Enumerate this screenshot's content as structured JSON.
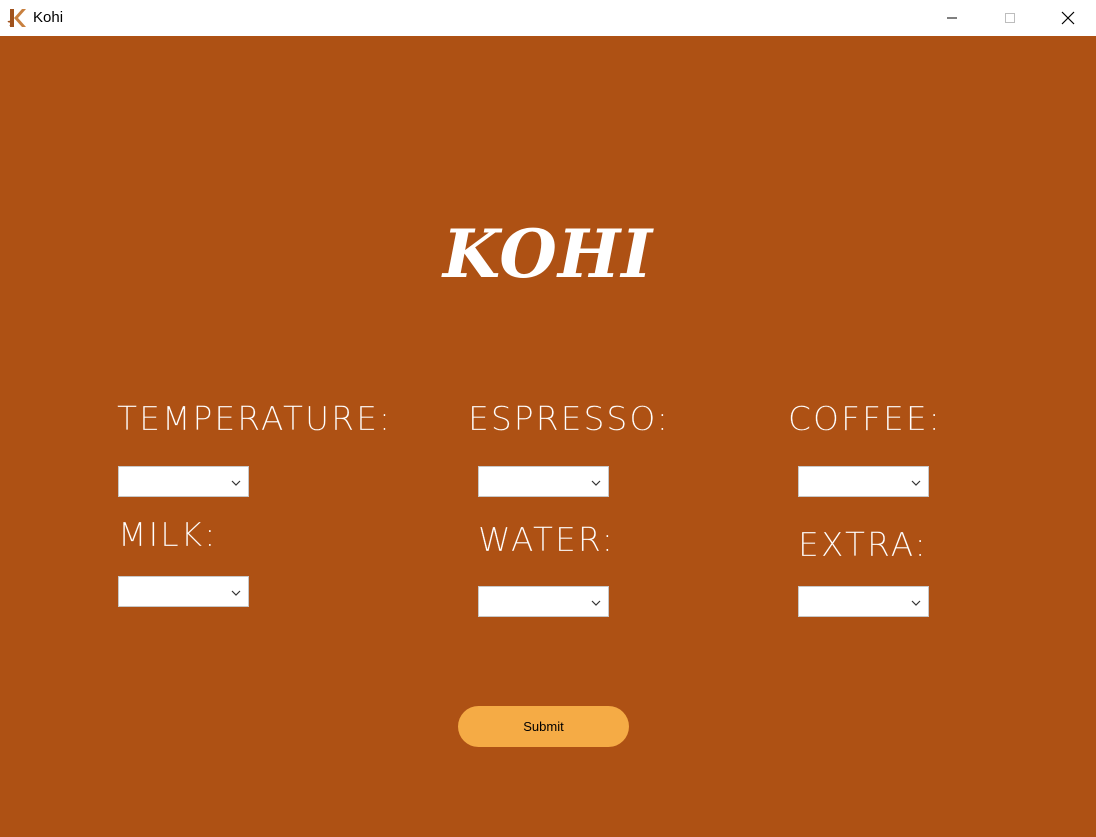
{
  "window": {
    "title": "Kohi",
    "icon": "kohi-logo-icon"
  },
  "titlebar_buttons": {
    "minimize": "minimize-icon",
    "maximize": "maximize-icon",
    "close": "close-icon"
  },
  "main": {
    "brand": "KOHI",
    "background_color": "#ae5114",
    "fields": {
      "temperature": {
        "label": "TEMPERATURE:",
        "value": ""
      },
      "milk": {
        "label": "MILK:",
        "value": ""
      },
      "espresso": {
        "label": "ESPRESSO:",
        "value": ""
      },
      "water": {
        "label": "WATER:",
        "value": ""
      },
      "coffee": {
        "label": "COFFEE:",
        "value": ""
      },
      "extra": {
        "label": "EXTRA:",
        "value": ""
      }
    },
    "submit_label": "Submit",
    "submit_color": "#f5ab45"
  }
}
